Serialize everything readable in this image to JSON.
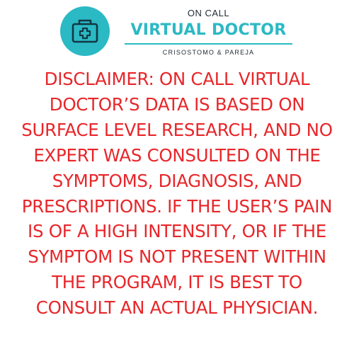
{
  "header": {
    "logo_icon": "medical-kit-icon",
    "brand_top": "ON CALL",
    "brand_name": "VIRTUAL DOCTOR",
    "authors": "CRISOSTOMO & PAREJA"
  },
  "disclaimer": {
    "lines": [
      "DISCLAIMER: ON CALL VIRTUAL",
      "DOCTOR’S DATA IS BASED ON",
      "SURFACE LEVEL RESEARCH, AND NO",
      "EXPERT WAS CONSULTED ON THE",
      "SYMPTOMS, DIAGNOSIS, AND",
      "PRESCRIPTIONS. IF THE USER’S PAIN",
      "IS OF A HIGH INTENSITY, OR IF THE",
      "SYMPTOM IS NOT PRESENT WITHIN",
      "THE PROGRAM, IT IS BEST TO",
      "CONSULT AN ACTUAL PHYSICIAN."
    ]
  },
  "colors": {
    "brand_teal": "#2bb9c4",
    "disclaimer_red": "#e8262a",
    "dark_text": "#1f2a33",
    "background": "#ffffff"
  }
}
